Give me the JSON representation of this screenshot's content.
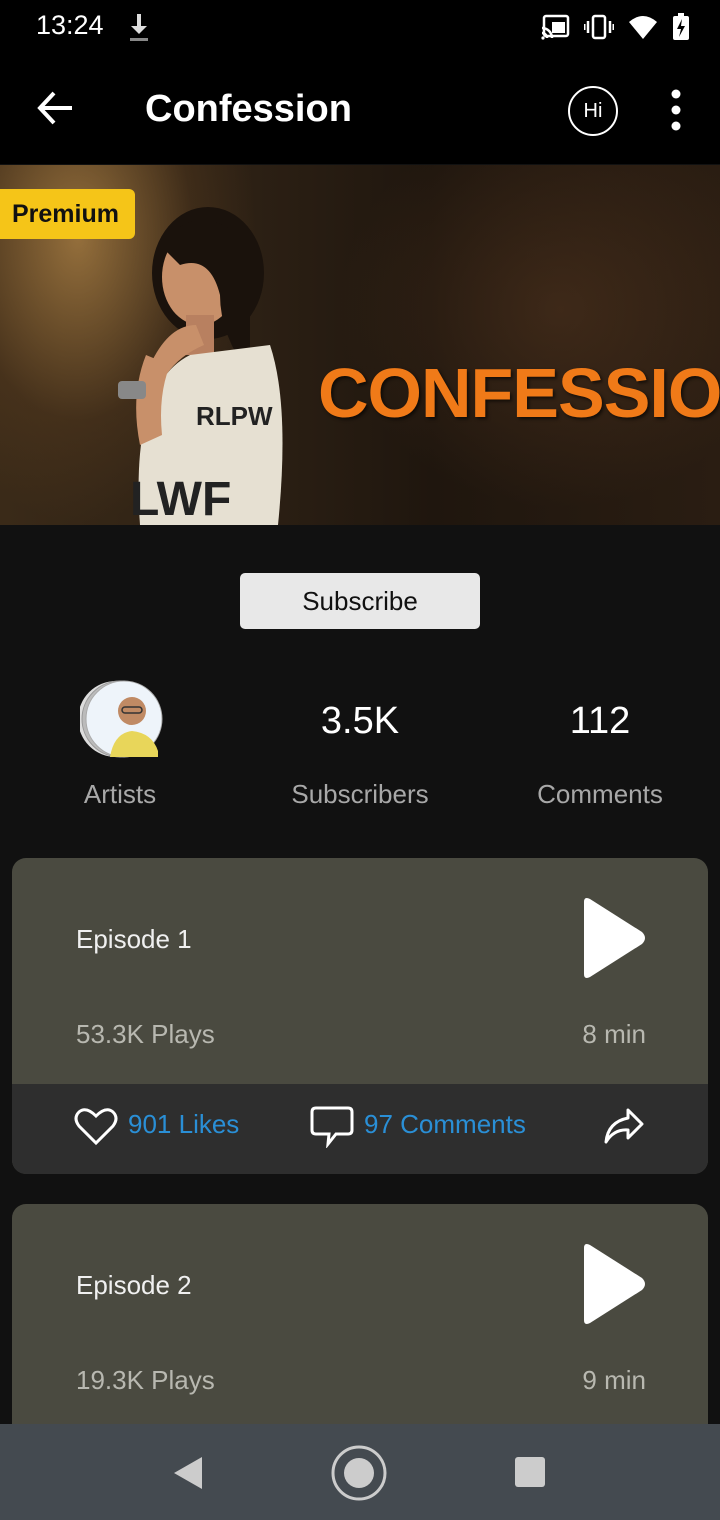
{
  "status_bar": {
    "time": "13:24",
    "icons": [
      "download-icon",
      "cast-icon",
      "vibrate-icon",
      "wifi-icon",
      "battery-icon"
    ]
  },
  "app_bar": {
    "title": "Confession",
    "hi_label": "Hi"
  },
  "banner": {
    "badge": "Premium",
    "title_art": "CONFESSION"
  },
  "subscribe_label": "Subscribe",
  "stats": {
    "artists_label": "Artists",
    "subscribers_value": "3.5K",
    "subscribers_label": "Subscribers",
    "comments_value": "112",
    "comments_label": "Comments"
  },
  "episodes": [
    {
      "title": "Episode 1",
      "plays": "53.3K  Plays",
      "duration": "8 min",
      "likes": "901 Likes",
      "comments": "97 Comments"
    },
    {
      "title": "Episode 2",
      "plays": "19.3K  Plays",
      "duration": "9 min"
    }
  ],
  "colors": {
    "accent": "#2a8fd6",
    "badge": "#f5c518",
    "card": "#4a4a40",
    "title_art": "#f07a18"
  }
}
